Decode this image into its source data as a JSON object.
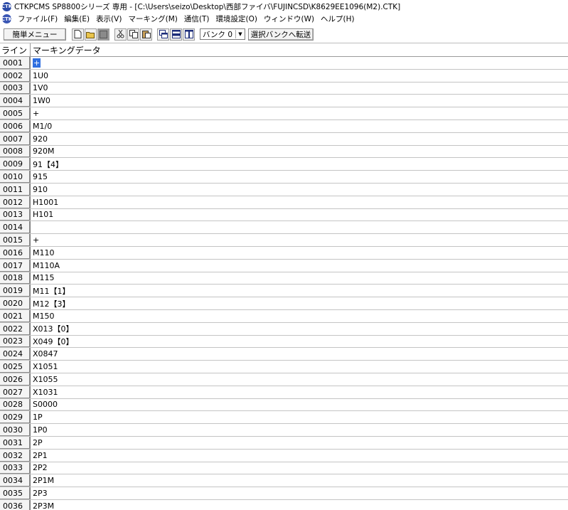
{
  "window": {
    "icon": "ctk-app-icon",
    "title": "CTKPCMS SP8800シリーズ 専用 - [C:\\Users\\seizo\\Desktop\\西部ファイバ\\FUJINCSD\\K8629EE1096(M2).CTK]"
  },
  "menubar": {
    "items": [
      "ファイル(F)",
      "編集(E)",
      "表示(V)",
      "マーキング(M)",
      "通信(T)",
      "環境設定(O)",
      "ウィンドウ(W)",
      "ヘルプ(H)"
    ]
  },
  "toolbar": {
    "simple_menu_label": "簡単メニュー",
    "bank_select_value": "バンク 0",
    "transfer_button_label": "選択バンクへ転送"
  },
  "grid": {
    "columns": [
      "ライン",
      "マーキングデータ"
    ],
    "rows": [
      {
        "line": "0001",
        "data": "+"
      },
      {
        "line": "0002",
        "data": "1U0"
      },
      {
        "line": "0003",
        "data": "1V0"
      },
      {
        "line": "0004",
        "data": "1W0"
      },
      {
        "line": "0005",
        "data": "+"
      },
      {
        "line": "0006",
        "data": "M1/0"
      },
      {
        "line": "0007",
        "data": "920"
      },
      {
        "line": "0008",
        "data": "920M"
      },
      {
        "line": "0009",
        "data": "91【4】"
      },
      {
        "line": "0010",
        "data": "915"
      },
      {
        "line": "0011",
        "data": "910"
      },
      {
        "line": "0012",
        "data": "H1001"
      },
      {
        "line": "0013",
        "data": "H101"
      },
      {
        "line": "0014",
        "data": ""
      },
      {
        "line": "0015",
        "data": "+"
      },
      {
        "line": "0016",
        "data": "M110"
      },
      {
        "line": "0017",
        "data": "M110A"
      },
      {
        "line": "0018",
        "data": "M115"
      },
      {
        "line": "0019",
        "data": "M11【1】"
      },
      {
        "line": "0020",
        "data": "M12【3】"
      },
      {
        "line": "0021",
        "data": "M150"
      },
      {
        "line": "0022",
        "data": "X013【0】"
      },
      {
        "line": "0023",
        "data": "X049【0】"
      },
      {
        "line": "0024",
        "data": "X0847"
      },
      {
        "line": "0025",
        "data": "X1051"
      },
      {
        "line": "0026",
        "data": "X1055"
      },
      {
        "line": "0027",
        "data": "X1031"
      },
      {
        "line": "0028",
        "data": "S0000"
      },
      {
        "line": "0029",
        "data": "1P"
      },
      {
        "line": "0030",
        "data": "1P0"
      },
      {
        "line": "0031",
        "data": "2P"
      },
      {
        "line": "0032",
        "data": "2P1"
      },
      {
        "line": "0033",
        "data": "2P2"
      },
      {
        "line": "0034",
        "data": "2P1M"
      },
      {
        "line": "0035",
        "data": "2P3"
      },
      {
        "line": "0036",
        "data": "2P3M"
      }
    ]
  }
}
